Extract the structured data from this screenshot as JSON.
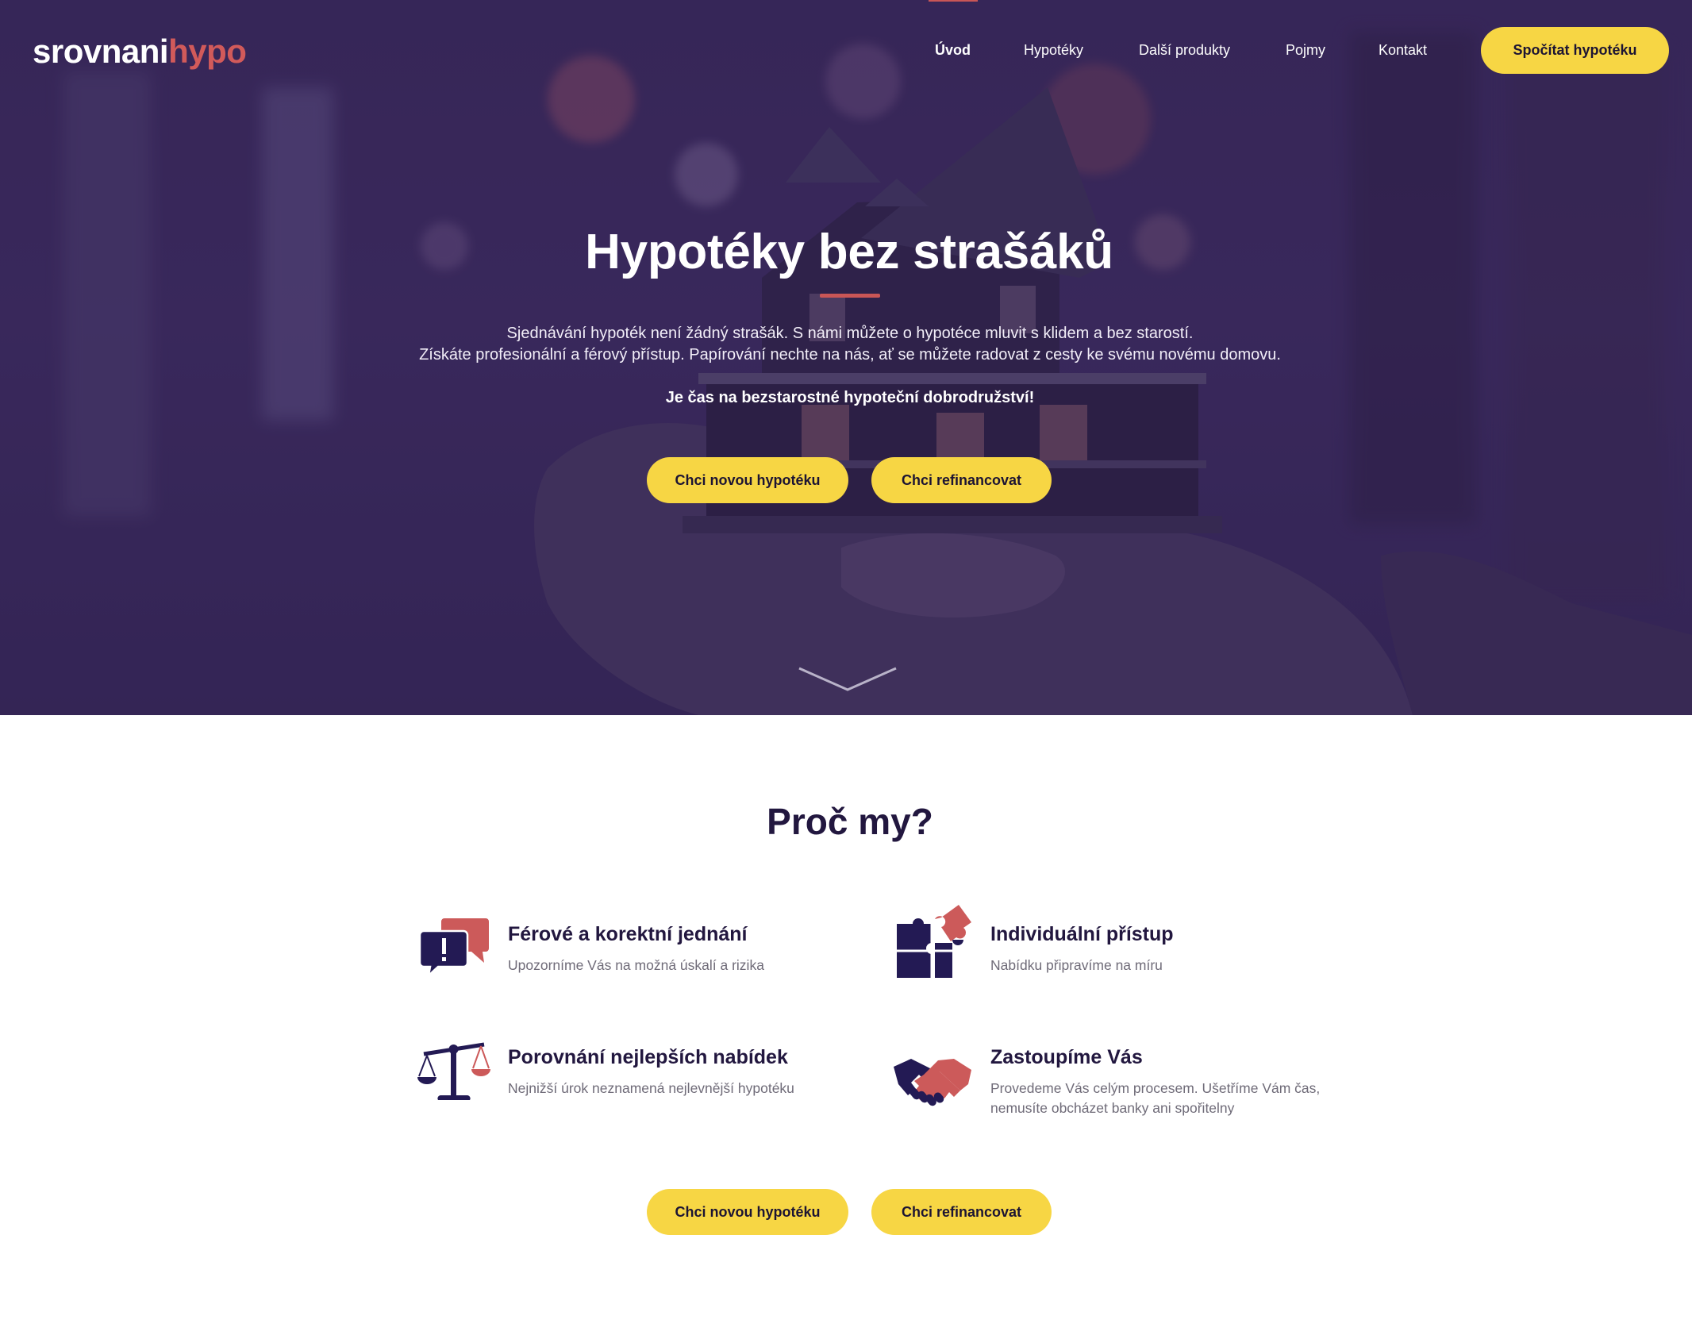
{
  "brand": {
    "logo_part1": "srovnani",
    "logo_part2": "hypo"
  },
  "nav": {
    "items": [
      {
        "label": "Úvod",
        "active": true
      },
      {
        "label": "Hypotéky",
        "active": false
      },
      {
        "label": "Další produkty",
        "active": false
      },
      {
        "label": "Pojmy",
        "active": false
      },
      {
        "label": "Kontakt",
        "active": false
      }
    ],
    "cta_label": "Spočítat hypotéku"
  },
  "hero": {
    "title": "Hypotéky bez strašáků",
    "line1": "Sjednávání hypoték není žádný strašák. S námi můžete o hypotéce mluvit s klidem a bez starostí.",
    "line2": "Získáte profesionální a férový přístup. Papírování nechte na nás, ať se můžete radovat z cesty ke svému novému domovu.",
    "tagline": "Je čas na bezstarostné hypoteční dobrodružství!",
    "btn_new": "Chci novou hypotéku",
    "btn_refi": "Chci refinancovat"
  },
  "why": {
    "title": "Proč my?",
    "features": [
      {
        "icon": "speech-bubbles-icon",
        "title": "Férové a korektní jednání",
        "desc": "Upozorníme Vás na možná úskalí a rizika"
      },
      {
        "icon": "puzzle-icon",
        "title": "Individuální přístup",
        "desc": "Nabídku připravíme na míru"
      },
      {
        "icon": "scales-icon",
        "title": "Porovnání nejlepších nabídek",
        "desc": "Nejnižší úrok neznamená nejlevnější hypotéku"
      },
      {
        "icon": "handshake-icon",
        "title": "Zastoupíme Vás",
        "desc_line1": "Provedeme Vás celým procesem. Ušetříme Vám čas,",
        "desc_line2": "nemusíte obcházet banky ani spořitelny"
      }
    ],
    "btn_new": "Chci novou hypotéku",
    "btn_refi": "Chci refinancovat"
  },
  "colors": {
    "accent_yellow": "#f7d644",
    "accent_red": "#c95656",
    "navy": "#22173f",
    "hero_purple": "#3e2d62"
  }
}
